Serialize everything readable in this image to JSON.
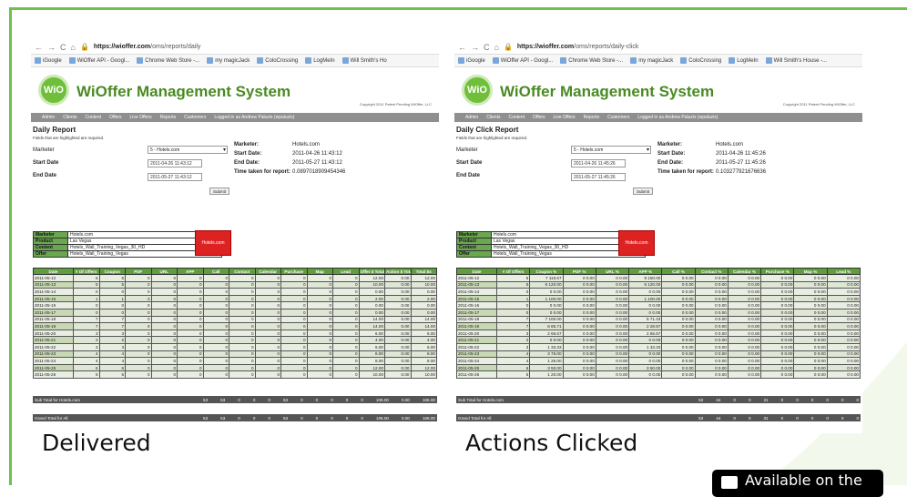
{
  "colors": {
    "accent": "#6cc24a",
    "brand_green": "#4a8a23",
    "table_header": "#5f9e3c"
  },
  "left": {
    "url_host": "https://wioffer.com",
    "url_path": "/oms/reports/daily",
    "bookmarks": [
      "iGoogle",
      "WiOffer API - Googl...",
      "Chrome Web Store -...",
      "my magicJack",
      "ColoCrossing",
      "LogMeIn",
      "Will Smith's Ho"
    ],
    "logo": "WiO",
    "app_title": "WiOffer Management System",
    "copyright": "Copyright 2011 Patent Pending WiOffer, LLC",
    "menu": [
      "Admin",
      "Clients",
      "Content",
      "Offers",
      "Live Offers",
      "Reports",
      "Customers",
      "Logged in as Andrew Paluzis (wpaluzis)"
    ],
    "report_title": "Daily Report",
    "note": "Fields that are highlighted are required.",
    "form": {
      "marketer_label": "Marketer",
      "marketer_value": "5 - Hotels.com",
      "start_label": "Start Date",
      "start_value": "2011-04-26 11:43:12",
      "end_label": "End Date",
      "end_value": "2011-05-27 11:43:12",
      "submit": "Submit"
    },
    "info": [
      {
        "k": "Marketer:",
        "v": "Hotels.com"
      },
      {
        "k": "Start Date:",
        "v": "2011-04-26 11:43:12"
      },
      {
        "k": "End Date:",
        "v": "2011-05-27 11:43:12"
      },
      {
        "k": "Time taken for report:",
        "v": "0.0897018909454346"
      }
    ],
    "mini": [
      {
        "k": "Marketer",
        "v": "Hotels.com"
      },
      {
        "k": "Product",
        "v": "Las Vegas"
      },
      {
        "k": "Content",
        "v": "Hotels_Wall_Training_Vegas_30_HD"
      },
      {
        "k": "Offer",
        "v": "Hotels_Wall_Training_Vegas"
      }
    ],
    "banner": "Hotels.com",
    "columns": [
      "Date",
      "# Of Offers",
      "Coupon",
      "PDF",
      "URL",
      "APP",
      "Call",
      "Contact",
      "Calendar",
      "Purchase",
      "Map",
      "Lead",
      "Offer $ Total",
      "Action $ Total",
      "Total $s"
    ],
    "rows": [
      [
        "2011-05-12",
        "6",
        "6",
        "0",
        "0",
        "0",
        "0",
        "0",
        "0",
        "0",
        "0",
        "0",
        "12.00",
        "0.00",
        "12.00"
      ],
      [
        "2011-05-13",
        "5",
        "5",
        "0",
        "0",
        "0",
        "0",
        "0",
        "0",
        "0",
        "0",
        "0",
        "10.00",
        "0.00",
        "10.00"
      ],
      [
        "2011-05-14",
        "0",
        "0",
        "0",
        "0",
        "0",
        "0",
        "0",
        "0",
        "0",
        "0",
        "0",
        "0.00",
        "0.00",
        "0.00"
      ],
      [
        "2011-05-15",
        "1",
        "1",
        "0",
        "0",
        "0",
        "0",
        "0",
        "0",
        "0",
        "0",
        "0",
        "2.00",
        "0.00",
        "2.00"
      ],
      [
        "2011-05-16",
        "0",
        "0",
        "0",
        "0",
        "0",
        "0",
        "0",
        "0",
        "0",
        "0",
        "0",
        "0.00",
        "0.00",
        "0.00"
      ],
      [
        "2011-05-17",
        "0",
        "0",
        "0",
        "0",
        "0",
        "0",
        "0",
        "0",
        "0",
        "0",
        "0",
        "0.00",
        "0.00",
        "0.00"
      ],
      [
        "2011-05-18",
        "7",
        "7",
        "0",
        "0",
        "0",
        "0",
        "0",
        "0",
        "0",
        "0",
        "0",
        "14.00",
        "0.00",
        "14.00"
      ],
      [
        "2011-05-19",
        "7",
        "7",
        "0",
        "0",
        "0",
        "0",
        "0",
        "0",
        "0",
        "0",
        "0",
        "14.00",
        "0.00",
        "14.00"
      ],
      [
        "2011-05-20",
        "3",
        "3",
        "0",
        "0",
        "0",
        "0",
        "0",
        "0",
        "0",
        "0",
        "0",
        "6.00",
        "0.00",
        "6.00"
      ],
      [
        "2011-05-21",
        "2",
        "2",
        "0",
        "0",
        "0",
        "0",
        "0",
        "0",
        "0",
        "0",
        "0",
        "4.00",
        "0.00",
        "4.00"
      ],
      [
        "2011-05-22",
        "3",
        "3",
        "0",
        "0",
        "0",
        "0",
        "0",
        "0",
        "0",
        "0",
        "0",
        "6.00",
        "0.00",
        "6.00"
      ],
      [
        "2011-05-23",
        "4",
        "4",
        "0",
        "0",
        "0",
        "0",
        "0",
        "0",
        "0",
        "0",
        "0",
        "8.00",
        "0.00",
        "8.00"
      ],
      [
        "2011-05-24",
        "4",
        "4",
        "0",
        "0",
        "0",
        "0",
        "0",
        "0",
        "0",
        "0",
        "0",
        "8.00",
        "0.00",
        "8.00"
      ],
      [
        "2011-05-25",
        "6",
        "6",
        "0",
        "0",
        "0",
        "0",
        "0",
        "0",
        "0",
        "0",
        "0",
        "12.00",
        "0.00",
        "12.00"
      ],
      [
        "2011-05-26",
        "5",
        "5",
        "0",
        "0",
        "0",
        "0",
        "0",
        "0",
        "0",
        "0",
        "0",
        "10.00",
        "0.00",
        "10.00"
      ]
    ],
    "subtotal": {
      "label": "Sub Total for Hotels.com",
      "values": [
        "53",
        "53",
        "0",
        "0",
        "0",
        "53",
        "0",
        "0",
        "0",
        "0",
        "0",
        "106.00",
        "0.00",
        "106.00"
      ]
    },
    "grand": {
      "label": "Grand Total for All",
      "values": [
        "53",
        "53",
        "0",
        "0",
        "0",
        "53",
        "0",
        "0",
        "0",
        "0",
        "0",
        "106.00",
        "0.00",
        "106.00"
      ]
    },
    "caption": "Delivered"
  },
  "right": {
    "url_host": "https://wioffer.com",
    "url_path": "/oms/reports/daily-click",
    "bookmarks": [
      "iGoogle",
      "WiOffer API - Googl...",
      "Chrome Web Store -...",
      "my magicJack",
      "ColoCrossing",
      "LogMeIn",
      "Will Smith's House -..."
    ],
    "logo": "WiO",
    "app_title": "WiOffer Management System",
    "copyright": "Copyright 2011 Patent Pending WiOffer, LLC",
    "menu": [
      "Admin",
      "Clients",
      "Content",
      "Offers",
      "Live Offers",
      "Reports",
      "Customers",
      "Logged in as Andrew Paluzis (wpaluzis)"
    ],
    "report_title": "Daily Click Report",
    "note": "Fields that are highlighted are required.",
    "form": {
      "marketer_label": "Marketer",
      "marketer_value": "5 - Hotels.com",
      "start_label": "Start Date",
      "start_value": "2011-04-26 11:45:26",
      "end_label": "End Date",
      "end_value": "2011-05-27 11:45:26",
      "submit": "Submit"
    },
    "info": [
      {
        "k": "Marketer:",
        "v": "Hotels.com"
      },
      {
        "k": "Start Date:",
        "v": "2011-04-26 11:45:26"
      },
      {
        "k": "End Date:",
        "v": "2011-05-27 11:45:26"
      },
      {
        "k": "Time taken for report:",
        "v": "0.103277921676636"
      }
    ],
    "mini": [
      {
        "k": "Marketer",
        "v": "Hotels.com"
      },
      {
        "k": "Product",
        "v": "Las Vegas"
      },
      {
        "k": "Content",
        "v": "Hotels_Wall_Training_Vegas_30_HD"
      },
      {
        "k": "Offer",
        "v": "Hotels_Wall_Training_Vegas"
      }
    ],
    "banner": "Hotels.com",
    "columns": [
      "Date",
      "# Of Offers",
      "Coupon %",
      "PDF %",
      "URL %",
      "APP %",
      "Call %",
      "Contact %",
      "Calendar %",
      "Purchase %",
      "Map %",
      "Lead %"
    ],
    "rows": [
      [
        "2011-05-12",
        "6",
        "7 116.67",
        "0 0.00",
        "0 0.00",
        "9 150.00",
        "0 0.00",
        "0 0.00",
        "0 0.00",
        "0 0.00",
        "0 0.00",
        "0 0.00"
      ],
      [
        "2011-05-13",
        "5",
        "6 120.00",
        "0 0.00",
        "0 0.00",
        "6 120.00",
        "0 0.00",
        "0 0.00",
        "0 0.00",
        "0 0.00",
        "0 0.00",
        "0 0.00"
      ],
      [
        "2011-05-14",
        "0",
        "0 0.00",
        "0 0.00",
        "0 0.00",
        "0 0.00",
        "0 0.00",
        "0 0.00",
        "0 0.00",
        "0 0.00",
        "0 0.00",
        "0 0.00"
      ],
      [
        "2011-05-15",
        "1",
        "1 100.00",
        "0 0.00",
        "0 0.00",
        "1 100.00",
        "0 0.00",
        "0 0.00",
        "0 0.00",
        "0 0.00",
        "0 0.00",
        "0 0.00"
      ],
      [
        "2011-05-16",
        "0",
        "0 0.00",
        "0 0.00",
        "0 0.00",
        "0 0.00",
        "0 0.00",
        "0 0.00",
        "0 0.00",
        "0 0.00",
        "0 0.00",
        "0 0.00"
      ],
      [
        "2011-05-17",
        "0",
        "0 0.00",
        "0 0.00",
        "0 0.00",
        "0 0.00",
        "0 0.00",
        "0 0.00",
        "0 0.00",
        "0 0.00",
        "0 0.00",
        "0 0.00"
      ],
      [
        "2011-05-18",
        "7",
        "7 100.00",
        "0 0.00",
        "0 0.00",
        "5 71.43",
        "0 0.00",
        "0 0.00",
        "0 0.00",
        "0 0.00",
        "0 0.00",
        "0 0.00"
      ],
      [
        "2011-05-19",
        "7",
        "6 85.71",
        "0 0.00",
        "0 0.00",
        "2 28.57",
        "0 0.00",
        "0 0.00",
        "0 0.00",
        "0 0.00",
        "0 0.00",
        "0 0.00"
      ],
      [
        "2011-05-20",
        "3",
        "2 66.67",
        "0 0.00",
        "0 0.00",
        "2 66.67",
        "0 0.00",
        "0 0.00",
        "0 0.00",
        "0 0.00",
        "0 0.00",
        "0 0.00"
      ],
      [
        "2011-05-21",
        "2",
        "0 0.00",
        "0 0.00",
        "0 0.00",
        "0 0.00",
        "0 0.00",
        "0 0.00",
        "0 0.00",
        "0 0.00",
        "0 0.00",
        "0 0.00"
      ],
      [
        "2011-05-22",
        "3",
        "1 33.33",
        "0 0.00",
        "0 0.00",
        "1 33.33",
        "0 0.00",
        "0 0.00",
        "0 0.00",
        "0 0.00",
        "0 0.00",
        "0 0.00"
      ],
      [
        "2011-05-23",
        "4",
        "3 75.00",
        "0 0.00",
        "0 0.00",
        "0 0.00",
        "0 0.00",
        "0 0.00",
        "0 0.00",
        "0 0.00",
        "0 0.00",
        "0 0.00"
      ],
      [
        "2011-05-24",
        "4",
        "1 25.00",
        "0 0.00",
        "0 0.00",
        "0 0.00",
        "0 0.00",
        "0 0.00",
        "0 0.00",
        "0 0.00",
        "0 0.00",
        "0 0.00"
      ],
      [
        "2011-05-25",
        "6",
        "3 50.00",
        "0 0.00",
        "0 0.00",
        "3 50.00",
        "0 0.00",
        "0 0.00",
        "0 0.00",
        "0 0.00",
        "0 0.00",
        "0 0.00"
      ],
      [
        "2011-05-26",
        "5",
        "1 20.00",
        "0 0.00",
        "0 0.00",
        "0 0.00",
        "0 0.00",
        "0 0.00",
        "0 0.00",
        "0 0.00",
        "0 0.00",
        "0 0.00"
      ]
    ],
    "subtotal": {
      "label": "Sub Total for Hotels.com",
      "values": [
        "53",
        "44",
        "0",
        "0",
        "31",
        "0",
        "0",
        "0",
        "0",
        "0",
        "0"
      ]
    },
    "grand": {
      "label": "Grand Total for All",
      "values": [
        "53",
        "44",
        "0",
        "0",
        "31",
        "0",
        "0",
        "0",
        "0",
        "0",
        "0"
      ]
    },
    "caption": "Actions Clicked"
  },
  "store_badge": "Available on the"
}
